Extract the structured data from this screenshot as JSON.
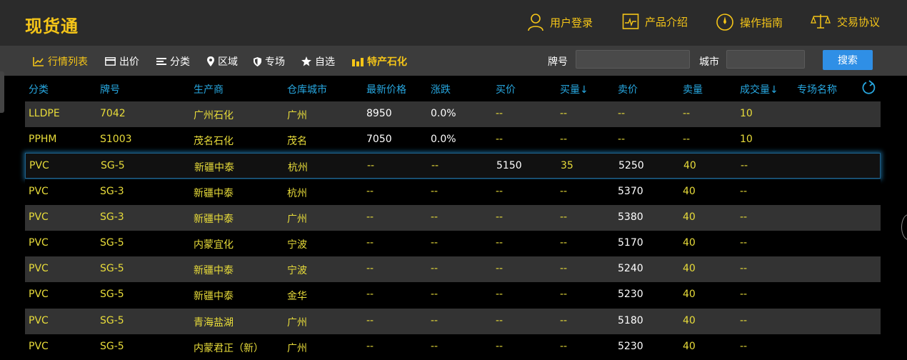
{
  "header": {
    "brand": "现货通",
    "nav": [
      {
        "label": "用户登录",
        "icon": "user-icon"
      },
      {
        "label": "产品介绍",
        "icon": "chart-monitor-icon"
      },
      {
        "label": "操作指南",
        "icon": "compass-icon"
      },
      {
        "label": "交易协议",
        "icon": "scale-icon"
      }
    ]
  },
  "toolbar": {
    "items": [
      {
        "label": "行情列表",
        "icon": "line-chart-icon",
        "active": true
      },
      {
        "label": "出价",
        "icon": "card-icon",
        "active": false
      },
      {
        "label": "分类",
        "icon": "list-icon",
        "active": false
      },
      {
        "label": "区域",
        "icon": "map-pin-icon",
        "active": false
      },
      {
        "label": "专场",
        "icon": "shield-icon",
        "active": false
      },
      {
        "label": "自选",
        "icon": "star-icon",
        "active": false
      },
      {
        "label": "特产石化",
        "icon": "bar-chart-icon",
        "active": true
      }
    ],
    "brand_label": "牌号",
    "brand_value": "",
    "city_label": "城市",
    "city_value": "",
    "search_label": "搜索"
  },
  "table": {
    "columns": [
      "分类",
      "牌号",
      "生产商",
      "仓库城市",
      "最新价格",
      "涨跌",
      "买价",
      "买量↓",
      "卖价",
      "卖量",
      "成交量↓",
      "专场名称"
    ],
    "rows": [
      [
        "LLDPE",
        "7042",
        "广州石化",
        "广州",
        "8950",
        "0.0%",
        "--",
        "--",
        "--",
        "--",
        "10",
        ""
      ],
      [
        "PPHM",
        "S1003",
        "茂名石化",
        "茂名",
        "7050",
        "0.0%",
        "--",
        "--",
        "--",
        "--",
        "10",
        ""
      ],
      [
        "PVC",
        "SG-5",
        "新疆中泰",
        "杭州",
        "--",
        "--",
        "5150",
        "35",
        "5250",
        "40",
        "--",
        ""
      ],
      [
        "PVC",
        "SG-3",
        "新疆中泰",
        "杭州",
        "--",
        "--",
        "--",
        "--",
        "5370",
        "40",
        "--",
        ""
      ],
      [
        "PVC",
        "SG-3",
        "新疆中泰",
        "广州",
        "--",
        "--",
        "--",
        "--",
        "5380",
        "40",
        "--",
        ""
      ],
      [
        "PVC",
        "SG-5",
        "内蒙宜化",
        "宁波",
        "--",
        "--",
        "--",
        "--",
        "5170",
        "40",
        "--",
        ""
      ],
      [
        "PVC",
        "SG-5",
        "新疆中泰",
        "宁波",
        "--",
        "--",
        "--",
        "--",
        "5240",
        "40",
        "--",
        ""
      ],
      [
        "PVC",
        "SG-5",
        "新疆中泰",
        "金华",
        "--",
        "--",
        "--",
        "--",
        "5230",
        "40",
        "--",
        ""
      ],
      [
        "PVC",
        "SG-5",
        "青海盐湖",
        "广州",
        "--",
        "--",
        "--",
        "--",
        "5180",
        "40",
        "--",
        ""
      ],
      [
        "PVC",
        "SG-5",
        "内蒙君正（新）",
        "广州",
        "--",
        "--",
        "--",
        "--",
        "5230",
        "40",
        "--",
        ""
      ]
    ],
    "selected_row": 2
  },
  "colors": {
    "accent": "#f5c518",
    "header_text": "#27a7e0",
    "cell_yellow": "#e8dc3a",
    "search_button": "#2f8fe6"
  }
}
